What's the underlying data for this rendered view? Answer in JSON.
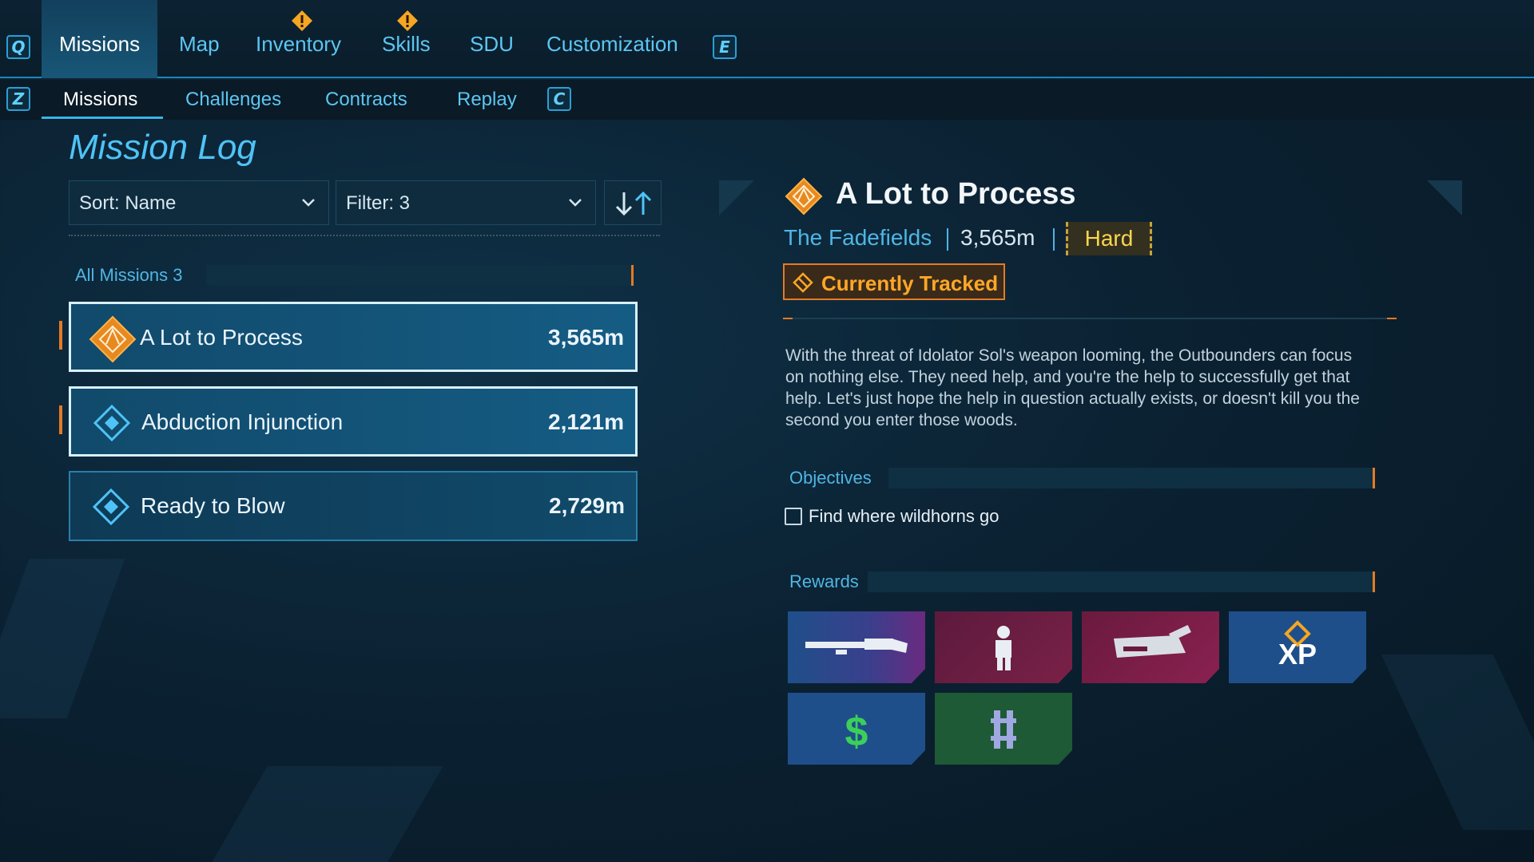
{
  "nav": {
    "left_key": "Q",
    "right_key": "E",
    "tabs": [
      {
        "label": "Missions",
        "active": true
      },
      {
        "label": "Map"
      },
      {
        "label": "Inventory",
        "alert": true
      },
      {
        "label": "Skills",
        "alert": true
      },
      {
        "label": "SDU"
      },
      {
        "label": "Customization"
      }
    ]
  },
  "subnav": {
    "left_key": "Z",
    "right_key": "C",
    "tabs": [
      {
        "label": "Missions",
        "active": true
      },
      {
        "label": "Challenges"
      },
      {
        "label": "Contracts"
      },
      {
        "label": "Replay"
      }
    ]
  },
  "mission_log": {
    "title": "Mission Log",
    "sort_label": "Sort: Name",
    "filter_label": "Filter: 3",
    "section_label": "All Missions 3",
    "missions": [
      {
        "name": "A Lot to Process",
        "distance": "3,565m",
        "tracked": true,
        "icon": "orange-diamond-icon"
      },
      {
        "name": "Abduction Injunction",
        "distance": "2,121m",
        "selected": true,
        "icon": "blue-diamond-icon"
      },
      {
        "name": "Ready to Blow",
        "distance": "2,729m",
        "icon": "blue-diamond-icon"
      }
    ]
  },
  "detail": {
    "title": "A Lot to Process",
    "location": "The Fadefields",
    "distance": "3,565m",
    "difficulty": "Hard",
    "tracked_label": "Currently Tracked",
    "description": "With the threat of Idolator Sol's weapon looming, the Outbounders can focus on nothing else. They need help, and you're the help to successfully get that help. Let's just hope the help in question actually exists, or doesn't kill you the second you enter those woods.",
    "objectives_label": "Objectives",
    "objectives": [
      "Find where wildhorns go"
    ],
    "rewards_label": "Rewards",
    "rewards": [
      {
        "icon": "shotgun-icon",
        "color": "#1f4f8a"
      },
      {
        "icon": "character-icon",
        "color": "#6a1f45"
      },
      {
        "icon": "weapon-bundle-icon",
        "color": "#6a1f45"
      },
      {
        "icon": "xp-icon",
        "label": "XP",
        "color": "#1f4f8a"
      },
      {
        "icon": "dollar-icon",
        "color": "#1f4f8a"
      },
      {
        "icon": "credit-icon",
        "color": "#1e5a35"
      }
    ]
  },
  "colors": {
    "accent": "#4fc3f7",
    "track": "#e57a24",
    "hard": "#ffd54f"
  }
}
